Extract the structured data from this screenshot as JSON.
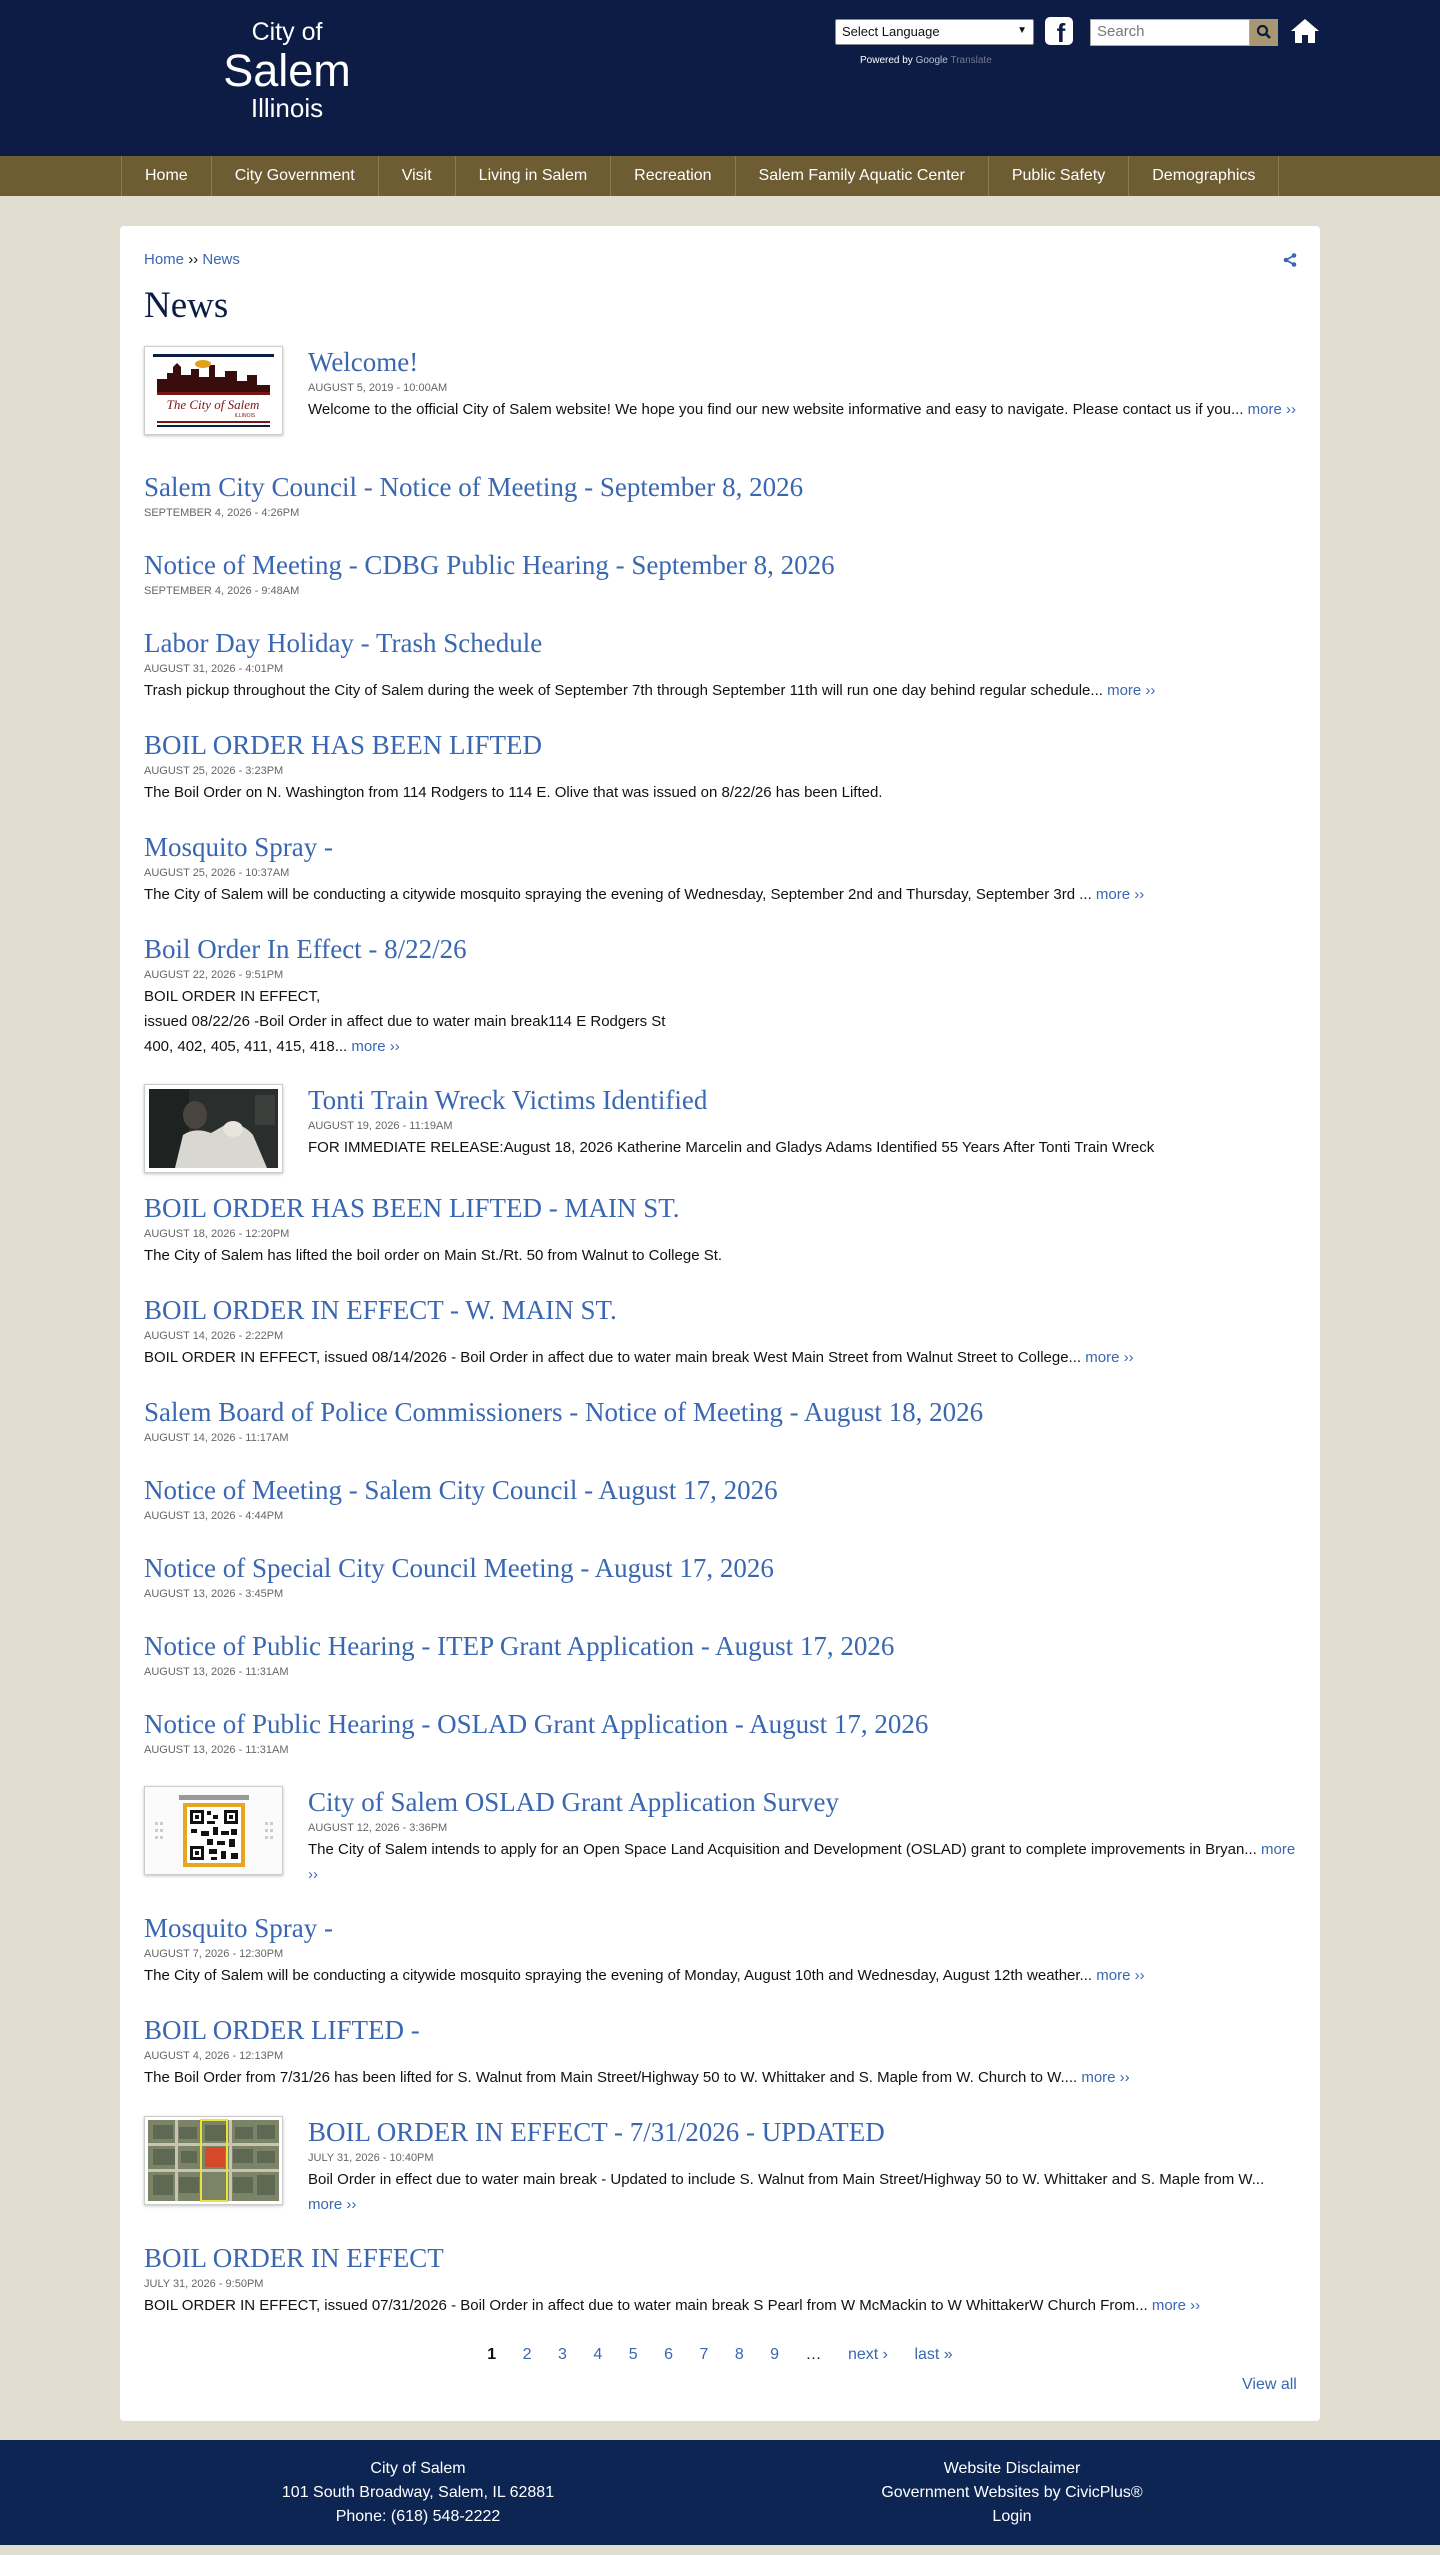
{
  "header": {
    "logo": {
      "line1": "City of",
      "line2": "Salem",
      "line3": "Illinois"
    },
    "language_select": "Select Language",
    "powered_by": "Powered by",
    "google": "Google",
    "translate": "Translate",
    "search_placeholder": "Search"
  },
  "nav": [
    "Home",
    "City Government",
    "Visit",
    "Living in Salem",
    "Recreation",
    "Salem Family Aquatic Center",
    "Public Safety",
    "Demographics"
  ],
  "breadcrumb": {
    "home": "Home",
    "sep": "››",
    "current": "News"
  },
  "page_title": "News",
  "more_label": "more ››",
  "news": [
    {
      "title": "Welcome!",
      "date": "August 5, 2019 - 10:00AM",
      "desc": "Welcome to the official City of Salem website! We hope you find our new website informative and easy to navigate. Please contact us if you...",
      "more": true,
      "image": "logo"
    },
    {
      "title": "Salem City Council - Notice of Meeting - September 8, 2026",
      "date": "September 4, 2026 - 4:26PM"
    },
    {
      "title": "Notice of Meeting - CDBG Public Hearing - September 8, 2026",
      "date": "September 4, 2026 - 9:48AM"
    },
    {
      "title": "Labor Day Holiday - Trash Schedule",
      "date": "August 31, 2026 - 4:01PM",
      "desc": "Trash pickup throughout the City of Salem during the week of September 7th through September 11th will run one day behind regular schedule...",
      "more": true
    },
    {
      "title": "BOIL ORDER HAS BEEN LIFTED",
      "date": "August 25, 2026 - 3:23PM",
      "desc": "The Boil Order on N. Washington from 114 Rodgers to 114 E. Olive that was issued on 8/22/26 has been Lifted."
    },
    {
      "title": "Mosquito Spray -",
      "date": "August 25, 2026 - 10:37AM",
      "desc": "The City of Salem will be conducting a citywide mosquito spraying the evening of Wednesday, September 2nd and Thursday, September 3rd ...",
      "more": true
    },
    {
      "title": "Boil Order In Effect - 8/22/26",
      "date": "August 22, 2026 - 9:51PM",
      "desc_lines": [
        "BOIL ORDER IN EFFECT,",
        "issued 08/22/26 -Boil Order in affect due to water main break114 E Rodgers St",
        "400, 402, 405, 411, 415, 418..."
      ],
      "more": true
    },
    {
      "title": "Tonti Train Wreck Victims Identified",
      "date": "August 19, 2026 - 11:19AM",
      "desc": "FOR IMMEDIATE RELEASE:August 18, 2026 Katherine Marcelin and Gladys Adams Identified 55 Years After Tonti Train Wreck",
      "image": "photo"
    },
    {
      "title": "BOIL ORDER HAS BEEN LIFTED - MAIN ST.",
      "date": "August 18, 2026 - 12:20PM",
      "desc": "The City of Salem has lifted the boil order on Main St./Rt. 50 from Walnut to College St."
    },
    {
      "title": "BOIL ORDER IN EFFECT - W. MAIN ST.",
      "date": "August 14, 2026 - 2:22PM",
      "desc": "BOIL ORDER IN EFFECT, issued 08/14/2026 - Boil Order in affect due to water main break West Main Street from Walnut Street to College...",
      "more": true
    },
    {
      "title": "Salem Board of Police Commissioners - Notice of Meeting - August 18, 2026",
      "date": "August 14, 2026 - 11:17AM"
    },
    {
      "title": "Notice of Meeting - Salem City Council - August 17, 2026",
      "date": "August 13, 2026 - 4:44PM"
    },
    {
      "title": "Notice of Special City Council Meeting - August 17, 2026",
      "date": "August 13, 2026 - 3:45PM"
    },
    {
      "title": "Notice of Public Hearing - ITEP Grant Application - August 17, 2026",
      "date": "August 13, 2026 - 11:31AM"
    },
    {
      "title": "Notice of Public Hearing - OSLAD Grant Application - August 17, 2026",
      "date": "August 13, 2026 - 11:31AM"
    },
    {
      "title": "City of Salem OSLAD Grant Application Survey",
      "date": "August 12, 2026 - 3:36PM",
      "desc": "The City of Salem intends to apply for an Open Space Land Acquisition and Development (OSLAD) grant to complete improvements in Bryan...",
      "more": true,
      "image": "qr"
    },
    {
      "title": "Mosquito Spray -",
      "date": "August 7, 2026 - 12:30PM",
      "desc": "The City of Salem will be conducting a citywide mosquito spraying the evening of Monday, August 10th and Wednesday, August 12th weather...",
      "more": true
    },
    {
      "title": "BOIL ORDER LIFTED -",
      "date": "August 4, 2026 - 12:13PM",
      "desc": "The Boil Order from 7/31/26 has been lifted for S. Walnut from Main Street/Highway 50 to W. Whittaker and S. Maple from W. Church to W....",
      "more": true
    },
    {
      "title": "BOIL ORDER IN EFFECT - 7/31/2026 - UPDATED",
      "date": "July 31, 2026 - 10:40PM",
      "desc": "Boil Order in effect due to water main break - Updated to include S. Walnut from Main Street/Highway 50 to W. Whittaker and S. Maple from W...",
      "more": true,
      "image": "map"
    },
    {
      "title": "BOIL ORDER IN EFFECT",
      "date": "July 31, 2026 - 9:50PM",
      "desc": "BOIL ORDER IN EFFECT, issued 07/31/2026 - Boil Order in affect due to water main break S Pearl from W McMackin to W WhittakerW Church From...",
      "more": true
    }
  ],
  "logo_thumb": {
    "title": "The City of Salem",
    "subtitle": "ILLINOIS"
  },
  "pager": {
    "pages": [
      "1",
      "2",
      "3",
      "4",
      "5",
      "6",
      "7",
      "8",
      "9"
    ],
    "ellipsis": "…",
    "next": "next ›",
    "last": "last »",
    "view_all": "View all"
  },
  "footer": {
    "name": "City of Salem",
    "address": "101 South Broadway, Salem, IL 62881",
    "phone": "Phone: (618) 548-2222",
    "disclaimer": "Website Disclaimer",
    "civicplus": "Government Websites by CivicPlus®",
    "login": "Login"
  }
}
